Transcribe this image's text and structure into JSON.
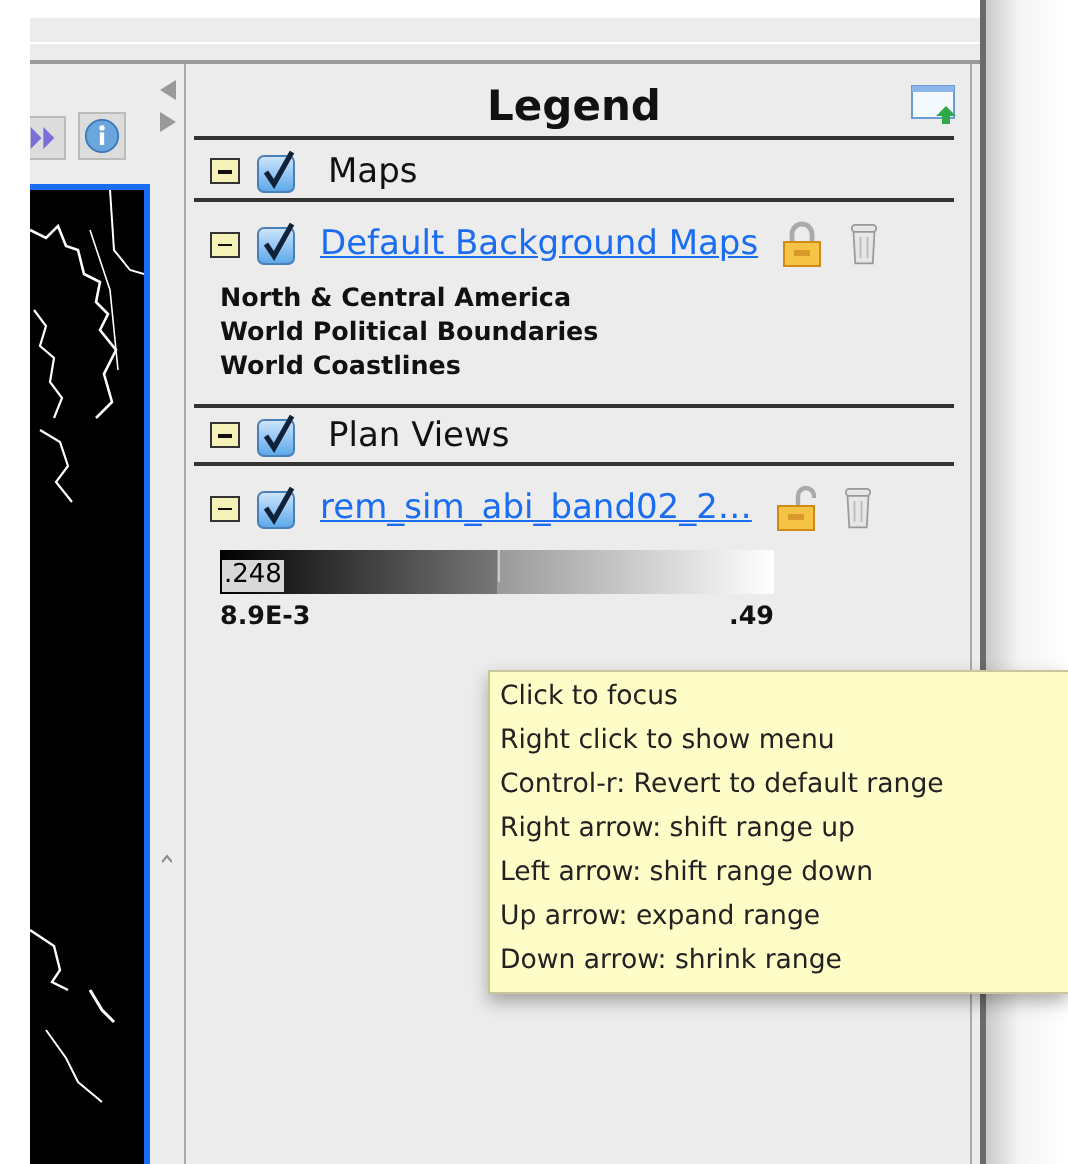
{
  "legend": {
    "title": "Legend"
  },
  "groups": [
    {
      "label": "Maps",
      "expanded": true,
      "checked": true,
      "layers": [
        {
          "label": "Default Background Maps",
          "expanded": true,
          "checked": true,
          "locked": true,
          "items": [
            "North & Central America",
            "World Political Boundaries",
            "World Coastlines"
          ]
        }
      ]
    },
    {
      "label": "Plan Views",
      "expanded": true,
      "checked": true,
      "layers": [
        {
          "label": "rem_sim_abi_band02_2…",
          "expanded": true,
          "checked": true,
          "locked": false,
          "colorbar": {
            "readout": ".248",
            "min": "8.9E-3",
            "max": ".49"
          }
        }
      ]
    }
  ],
  "tooltip": {
    "lines": [
      "Click to focus",
      "Right click to show menu",
      "Control-r: Revert to default range",
      "Right arrow: shift range up",
      "Left arrow: shift range down",
      "Up arrow: expand range",
      "Down arrow: shrink range"
    ]
  }
}
